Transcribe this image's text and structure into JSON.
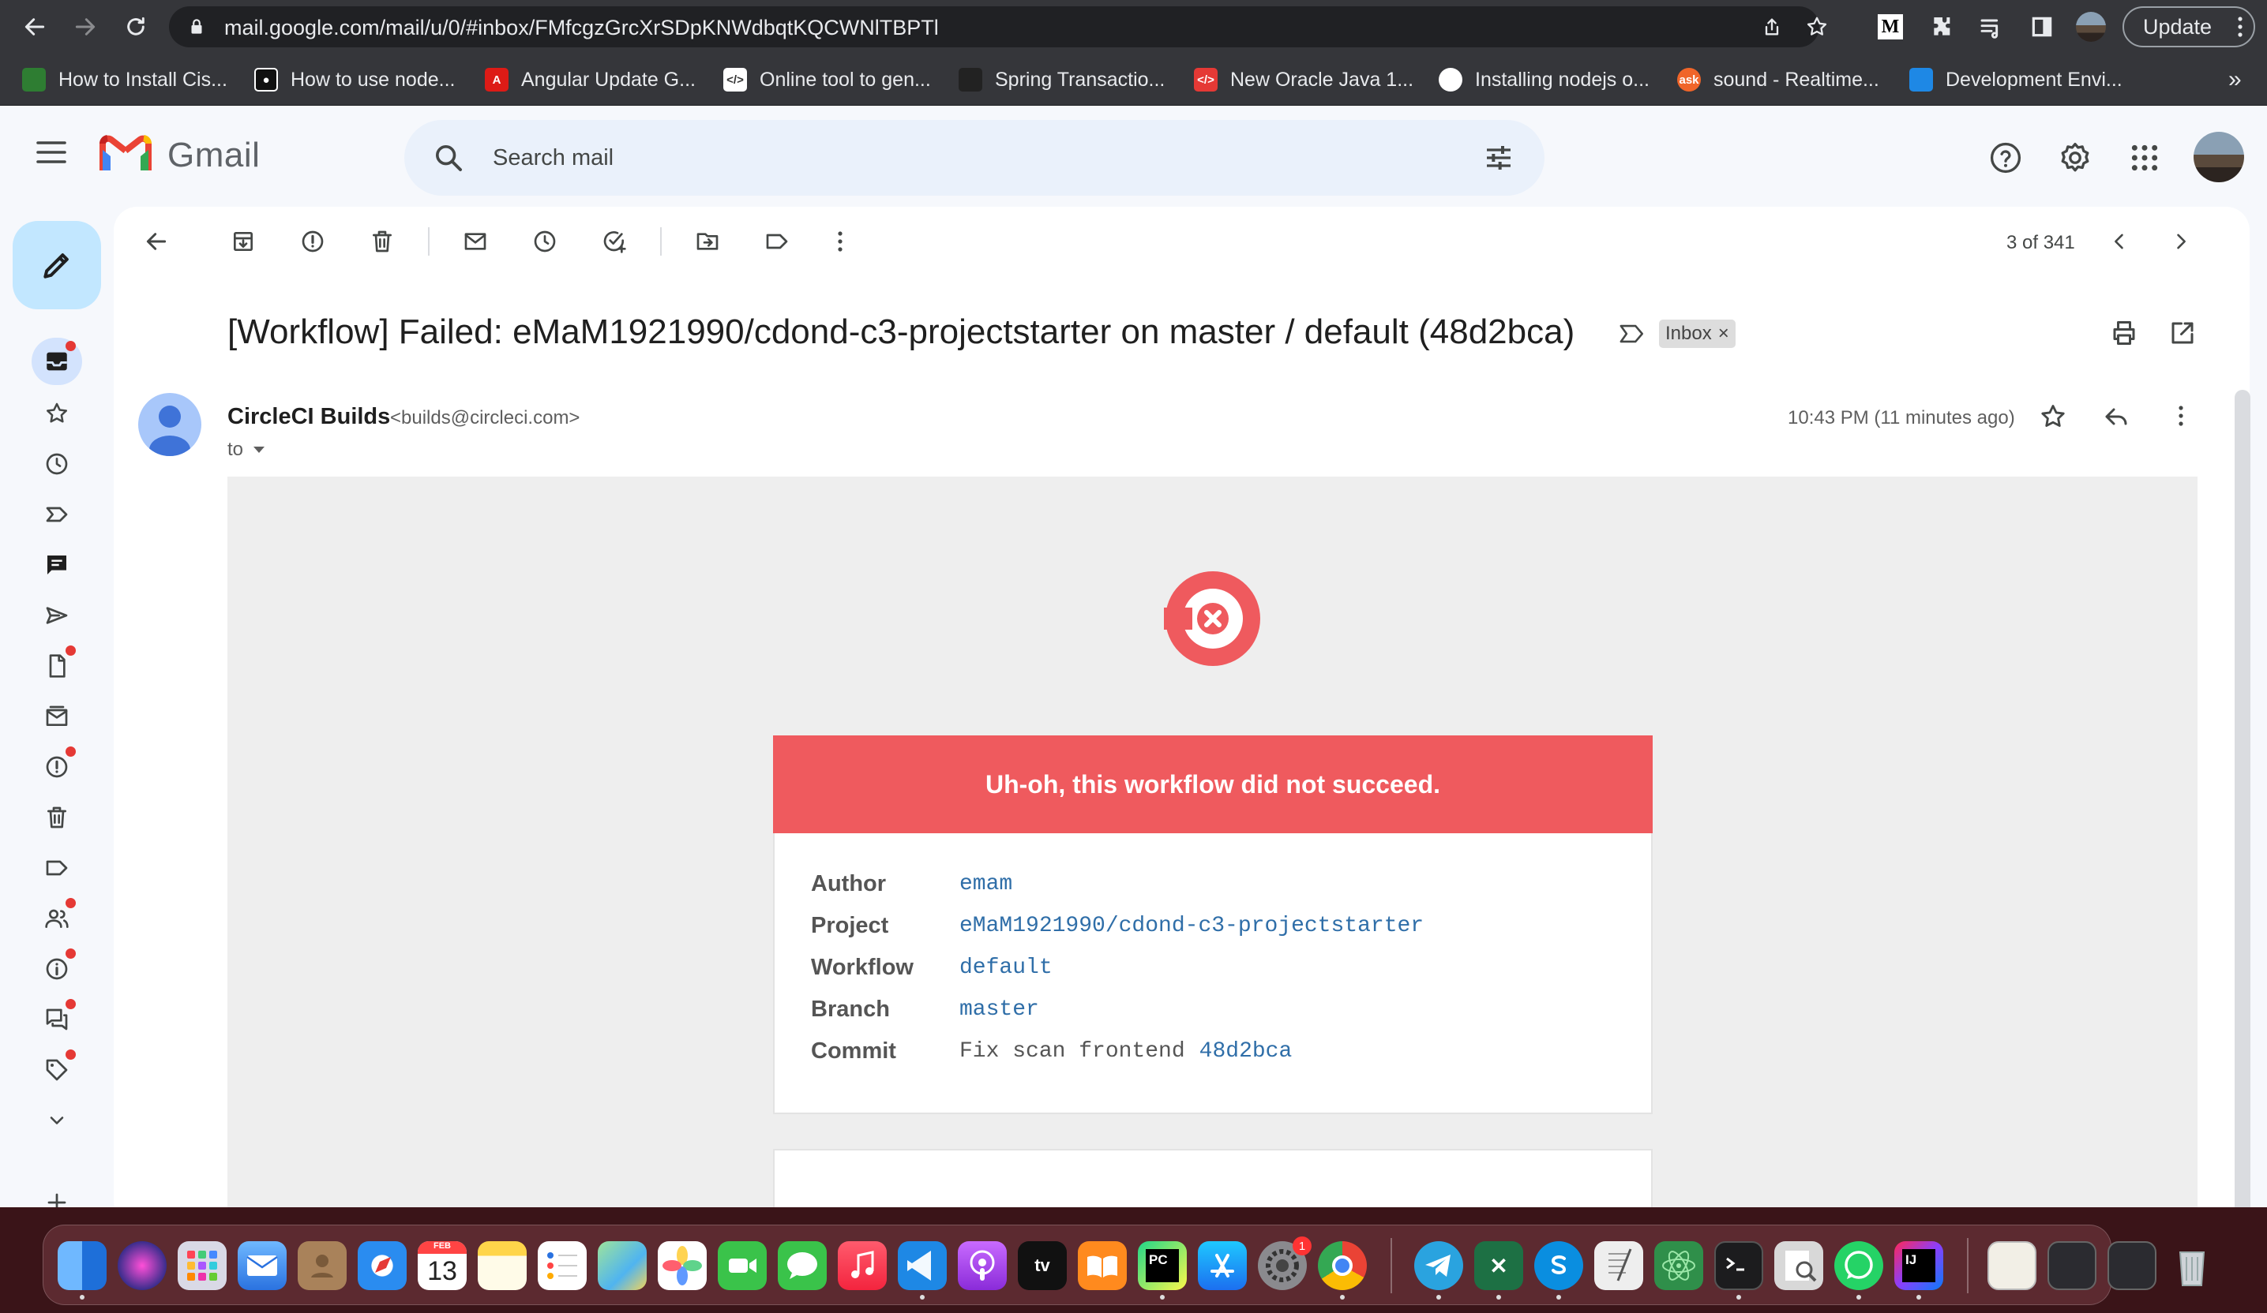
{
  "browser": {
    "url": "mail.google.com/mail/u/0/#inbox/FMfcgzGrcXrSDpKNWdbqtKQCWNlTBPTl",
    "update_label": "Update",
    "bookmarks": [
      {
        "label": "How to Install Cis...",
        "color": "#2e7d32"
      },
      {
        "label": "How to use node...",
        "color": "#111111"
      },
      {
        "label": "Angular Update G...",
        "color": "#dd1b16"
      },
      {
        "label": "Online tool to gen...",
        "color": "#ffffff"
      },
      {
        "label": "Spring Transactio...",
        "color": "#222222"
      },
      {
        "label": "New Oracle Java 1...",
        "color": "#e53935"
      },
      {
        "label": "Installing nodejs o...",
        "color": "#ffffff"
      },
      {
        "label": "sound - Realtime...",
        "color": "#f06529"
      },
      {
        "label": "Development Envi...",
        "color": "#1e88e5"
      }
    ],
    "more_bookmarks": "»"
  },
  "gmail": {
    "logo_text": "Gmail",
    "search_placeholder": "Search mail",
    "pager": "3 of 341",
    "subject": "[Workflow] Failed: eMaM1921990/cdond-c3-projectstarter on master / default (48d2bca)",
    "label_chip": "Inbox",
    "chip_close": "×",
    "sender_name": "CircleCI Builds",
    "sender_email": "<builds@circleci.com>",
    "to_label": "to",
    "timestamp": "10:43 PM (11 minutes ago)"
  },
  "email": {
    "banner": "Uh-oh, this workflow did not succeed.",
    "rows": [
      {
        "key": "Author",
        "value": "emam"
      },
      {
        "key": "Project",
        "value": "eMaM1921990/cdond-c3-projectstarter"
      },
      {
        "key": "Workflow",
        "value": "default"
      },
      {
        "key": "Branch",
        "value": "master"
      },
      {
        "key": "Commit",
        "message": "Fix scan frontend",
        "value": "48d2bca"
      }
    ],
    "accent": "#ef5a5e"
  },
  "dock": {
    "calendar_month": "FEB",
    "calendar_day": "13",
    "tv_label": "tv",
    "sysprefs_badge": "1",
    "pycharm_label": "PC",
    "intellij_label": "IJ"
  }
}
